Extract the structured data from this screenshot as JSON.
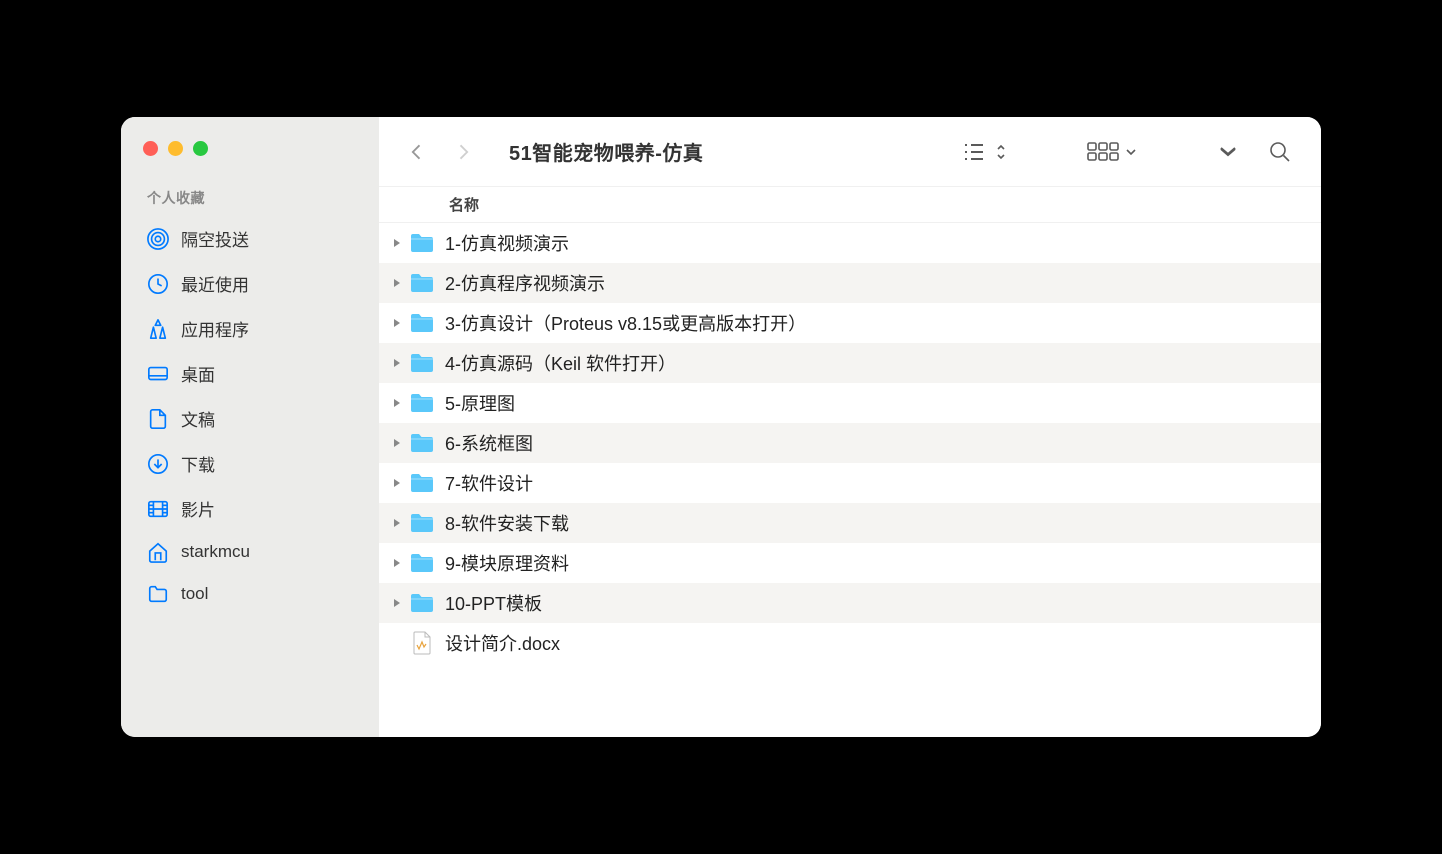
{
  "sidebar": {
    "header": "个人收藏",
    "items": [
      {
        "icon": "airdrop",
        "label": "隔空投送"
      },
      {
        "icon": "clock",
        "label": "最近使用"
      },
      {
        "icon": "apps",
        "label": "应用程序"
      },
      {
        "icon": "desktop",
        "label": "桌面"
      },
      {
        "icon": "document",
        "label": "文稿"
      },
      {
        "icon": "download",
        "label": "下载"
      },
      {
        "icon": "movie",
        "label": "影片"
      },
      {
        "icon": "home",
        "label": "starkmcu"
      },
      {
        "icon": "folder",
        "label": "tool"
      }
    ]
  },
  "toolbar": {
    "title": "51智能宠物喂养-仿真"
  },
  "columns": {
    "name": "名称"
  },
  "files": [
    {
      "type": "folder",
      "name": "1-仿真视频演示"
    },
    {
      "type": "folder",
      "name": "2-仿真程序视频演示"
    },
    {
      "type": "folder",
      "name": "3-仿真设计（Proteus v8.15或更高版本打开）"
    },
    {
      "type": "folder",
      "name": "4-仿真源码（Keil 软件打开）"
    },
    {
      "type": "folder",
      "name": "5-原理图"
    },
    {
      "type": "folder",
      "name": "6-系统框图"
    },
    {
      "type": "folder",
      "name": "7-软件设计"
    },
    {
      "type": "folder",
      "name": "8-软件安装下载"
    },
    {
      "type": "folder",
      "name": "9-模块原理资料"
    },
    {
      "type": "folder",
      "name": "10-PPT模板"
    },
    {
      "type": "docx",
      "name": "设计简介.docx"
    }
  ]
}
